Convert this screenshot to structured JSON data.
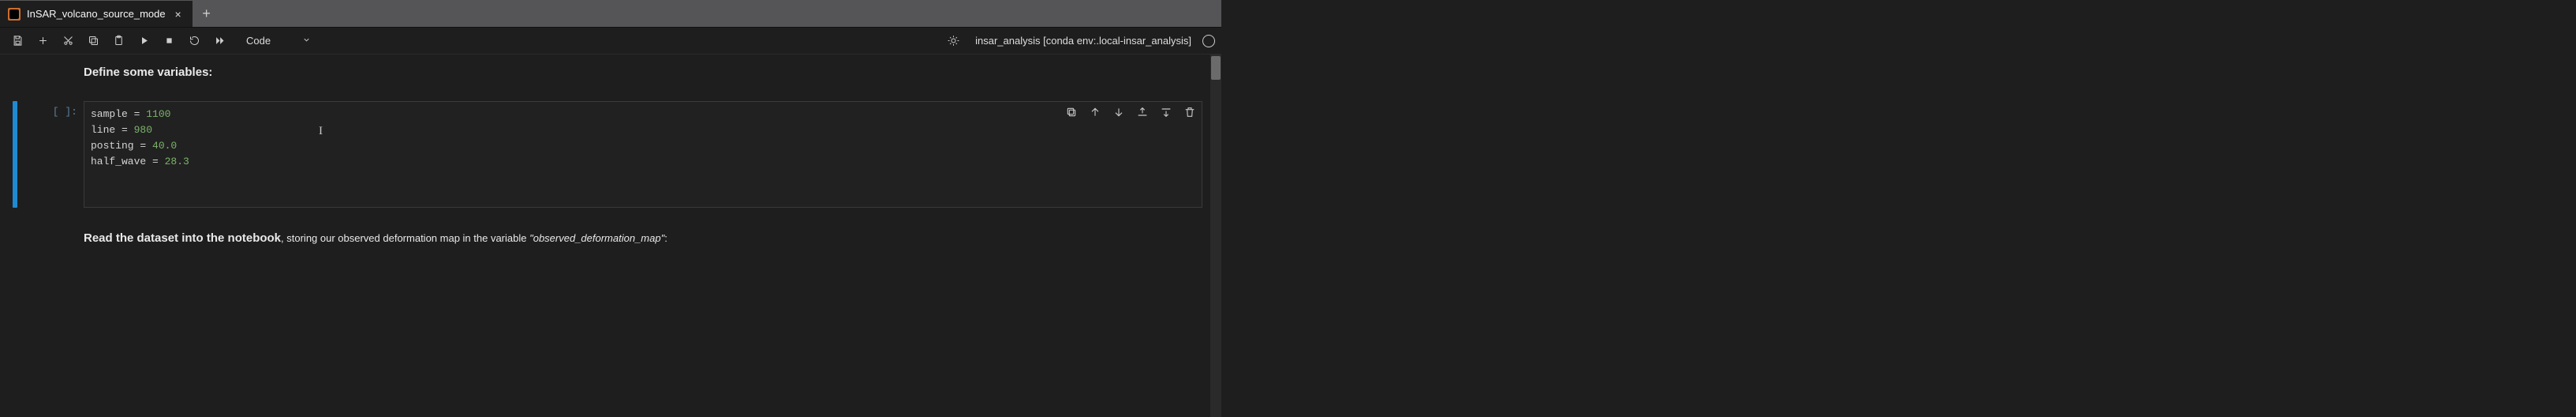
{
  "tab": {
    "title": "InSAR_volcano_source_mode",
    "icon_name": "notebook-file-icon"
  },
  "toolbar": {
    "celltype_label": "Code",
    "kernel_display": "insar_analysis [conda env:.local-insar_analysis]"
  },
  "markdown": {
    "heading1": "Define some variables:",
    "heading2_bold": "Read the dataset into the notebook",
    "heading2_rest": ", storing our observed deformation map in the variable ",
    "heading2_var": "observed_deformation_map",
    "heading2_tail": ":"
  },
  "cell": {
    "prompt": "[ ]:",
    "code_lines": [
      {
        "var": "sample",
        "op": " = ",
        "num": "1100"
      },
      {
        "var": "line",
        "op": " = ",
        "num": "980"
      },
      {
        "var": "posting",
        "op": " = ",
        "num": "40.0"
      },
      {
        "var": "half_wave",
        "op": " = ",
        "num": "28.3"
      }
    ]
  }
}
